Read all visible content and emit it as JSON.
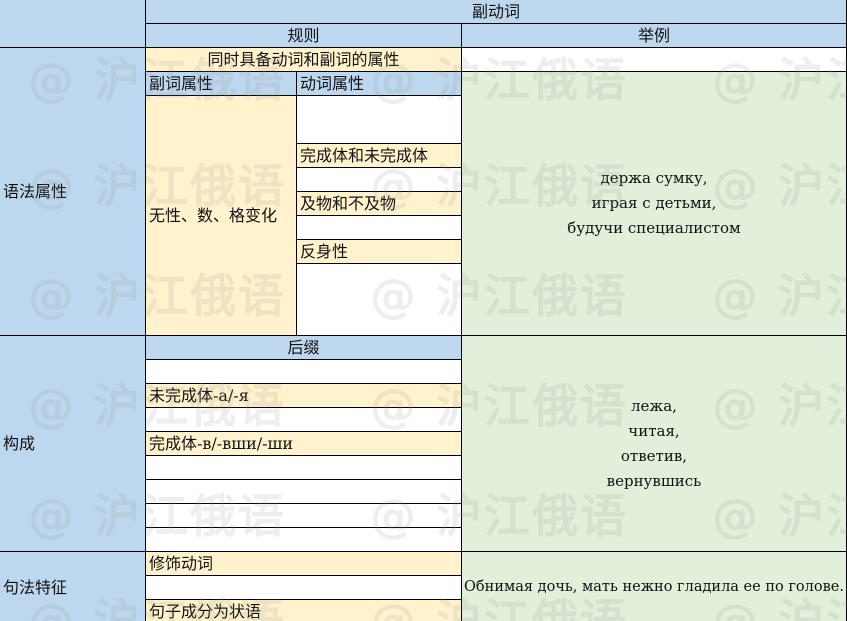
{
  "header": {
    "title": "副动词",
    "col_rules": "规则",
    "col_examples": "举例"
  },
  "grammar": {
    "row_label": "语法属性",
    "both_attrs": "同时具备动词和副词的属性",
    "adverb_attr": "副词属性",
    "verb_attr": "动词属性",
    "adverb_value": "无性、数、格变化",
    "verb_values": [
      "完成体和未完成体",
      "及物和不及物",
      "反身性"
    ],
    "examples": [
      "держа сумку,",
      "играя с детьми,",
      "будучи специалистом"
    ]
  },
  "formation": {
    "row_label": "构成",
    "suffix_header": "后缀",
    "imperfective": "未完成体-а/-я",
    "perfective": "完成体-в/-вши/-ши",
    "examples": [
      "лежа,",
      "читая,",
      "ответив,",
      "вернувшись"
    ]
  },
  "syntax": {
    "row_label": "句法特征",
    "modifies": "修饰动词",
    "role": "句子成分为状语",
    "example": "Обнимая дочь, мать нежно гладила ее по голове."
  },
  "watermark": "@ 沪江俄语"
}
